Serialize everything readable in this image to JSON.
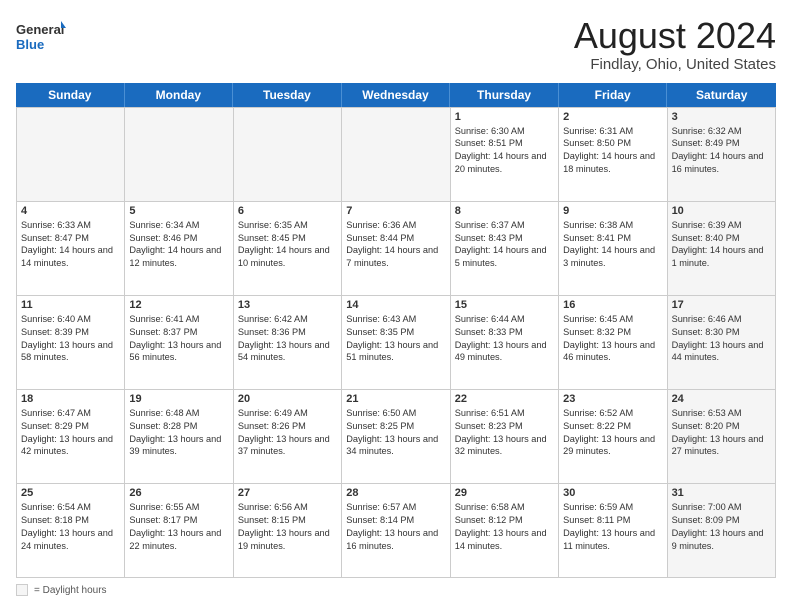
{
  "header": {
    "logo_line1": "General",
    "logo_line2": "Blue",
    "month": "August 2024",
    "location": "Findlay, Ohio, United States"
  },
  "weekdays": [
    "Sunday",
    "Monday",
    "Tuesday",
    "Wednesday",
    "Thursday",
    "Friday",
    "Saturday"
  ],
  "weeks": [
    [
      {
        "day": "",
        "info": "",
        "gray": true
      },
      {
        "day": "",
        "info": "",
        "gray": true
      },
      {
        "day": "",
        "info": "",
        "gray": true
      },
      {
        "day": "",
        "info": "",
        "gray": true
      },
      {
        "day": "1",
        "info": "Sunrise: 6:30 AM\nSunset: 8:51 PM\nDaylight: 14 hours and 20 minutes."
      },
      {
        "day": "2",
        "info": "Sunrise: 6:31 AM\nSunset: 8:50 PM\nDaylight: 14 hours and 18 minutes."
      },
      {
        "day": "3",
        "info": "Sunrise: 6:32 AM\nSunset: 8:49 PM\nDaylight: 14 hours and 16 minutes.",
        "gray": true
      }
    ],
    [
      {
        "day": "4",
        "info": "Sunrise: 6:33 AM\nSunset: 8:47 PM\nDaylight: 14 hours and 14 minutes."
      },
      {
        "day": "5",
        "info": "Sunrise: 6:34 AM\nSunset: 8:46 PM\nDaylight: 14 hours and 12 minutes."
      },
      {
        "day": "6",
        "info": "Sunrise: 6:35 AM\nSunset: 8:45 PM\nDaylight: 14 hours and 10 minutes."
      },
      {
        "day": "7",
        "info": "Sunrise: 6:36 AM\nSunset: 8:44 PM\nDaylight: 14 hours and 7 minutes."
      },
      {
        "day": "8",
        "info": "Sunrise: 6:37 AM\nSunset: 8:43 PM\nDaylight: 14 hours and 5 minutes."
      },
      {
        "day": "9",
        "info": "Sunrise: 6:38 AM\nSunset: 8:41 PM\nDaylight: 14 hours and 3 minutes."
      },
      {
        "day": "10",
        "info": "Sunrise: 6:39 AM\nSunset: 8:40 PM\nDaylight: 14 hours and 1 minute.",
        "gray": true
      }
    ],
    [
      {
        "day": "11",
        "info": "Sunrise: 6:40 AM\nSunset: 8:39 PM\nDaylight: 13 hours and 58 minutes."
      },
      {
        "day": "12",
        "info": "Sunrise: 6:41 AM\nSunset: 8:37 PM\nDaylight: 13 hours and 56 minutes."
      },
      {
        "day": "13",
        "info": "Sunrise: 6:42 AM\nSunset: 8:36 PM\nDaylight: 13 hours and 54 minutes."
      },
      {
        "day": "14",
        "info": "Sunrise: 6:43 AM\nSunset: 8:35 PM\nDaylight: 13 hours and 51 minutes."
      },
      {
        "day": "15",
        "info": "Sunrise: 6:44 AM\nSunset: 8:33 PM\nDaylight: 13 hours and 49 minutes."
      },
      {
        "day": "16",
        "info": "Sunrise: 6:45 AM\nSunset: 8:32 PM\nDaylight: 13 hours and 46 minutes."
      },
      {
        "day": "17",
        "info": "Sunrise: 6:46 AM\nSunset: 8:30 PM\nDaylight: 13 hours and 44 minutes.",
        "gray": true
      }
    ],
    [
      {
        "day": "18",
        "info": "Sunrise: 6:47 AM\nSunset: 8:29 PM\nDaylight: 13 hours and 42 minutes."
      },
      {
        "day": "19",
        "info": "Sunrise: 6:48 AM\nSunset: 8:28 PM\nDaylight: 13 hours and 39 minutes."
      },
      {
        "day": "20",
        "info": "Sunrise: 6:49 AM\nSunset: 8:26 PM\nDaylight: 13 hours and 37 minutes."
      },
      {
        "day": "21",
        "info": "Sunrise: 6:50 AM\nSunset: 8:25 PM\nDaylight: 13 hours and 34 minutes."
      },
      {
        "day": "22",
        "info": "Sunrise: 6:51 AM\nSunset: 8:23 PM\nDaylight: 13 hours and 32 minutes."
      },
      {
        "day": "23",
        "info": "Sunrise: 6:52 AM\nSunset: 8:22 PM\nDaylight: 13 hours and 29 minutes."
      },
      {
        "day": "24",
        "info": "Sunrise: 6:53 AM\nSunset: 8:20 PM\nDaylight: 13 hours and 27 minutes.",
        "gray": true
      }
    ],
    [
      {
        "day": "25",
        "info": "Sunrise: 6:54 AM\nSunset: 8:18 PM\nDaylight: 13 hours and 24 minutes."
      },
      {
        "day": "26",
        "info": "Sunrise: 6:55 AM\nSunset: 8:17 PM\nDaylight: 13 hours and 22 minutes."
      },
      {
        "day": "27",
        "info": "Sunrise: 6:56 AM\nSunset: 8:15 PM\nDaylight: 13 hours and 19 minutes."
      },
      {
        "day": "28",
        "info": "Sunrise: 6:57 AM\nSunset: 8:14 PM\nDaylight: 13 hours and 16 minutes."
      },
      {
        "day": "29",
        "info": "Sunrise: 6:58 AM\nSunset: 8:12 PM\nDaylight: 13 hours and 14 minutes."
      },
      {
        "day": "30",
        "info": "Sunrise: 6:59 AM\nSunset: 8:11 PM\nDaylight: 13 hours and 11 minutes."
      },
      {
        "day": "31",
        "info": "Sunrise: 7:00 AM\nSunset: 8:09 PM\nDaylight: 13 hours and 9 minutes.",
        "gray": true
      }
    ]
  ],
  "legend": {
    "box_label": "= Daylight hours"
  }
}
